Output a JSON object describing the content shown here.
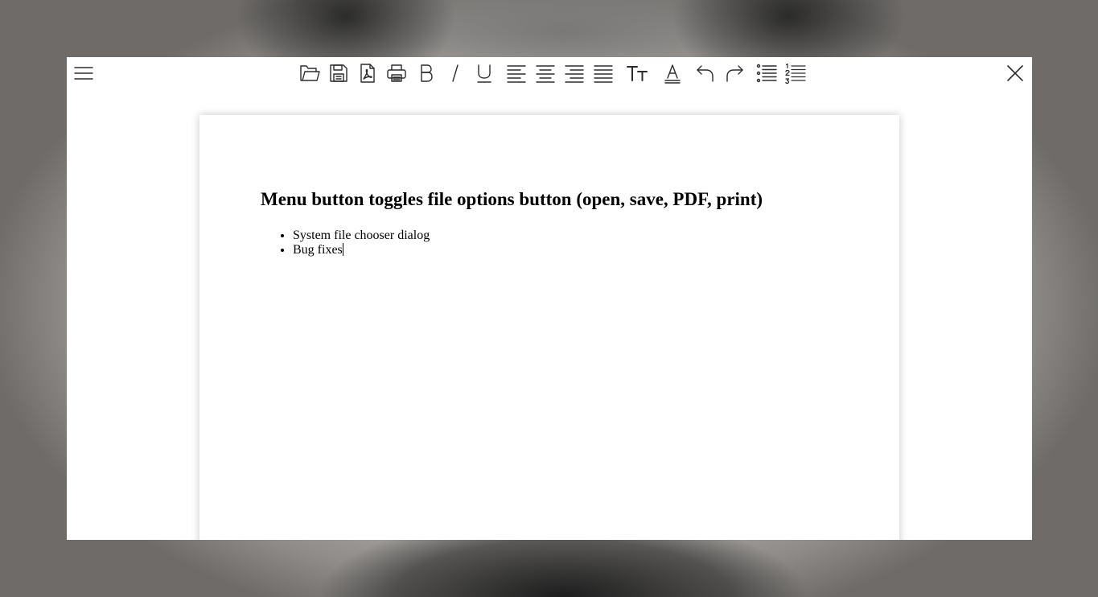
{
  "toolbar": {
    "menu_icon": "hamburger-menu-icon",
    "close_icon": "close-icon",
    "tools": [
      {
        "name": "open",
        "icon": "folder-open-icon"
      },
      {
        "name": "save",
        "icon": "save-icon"
      },
      {
        "name": "pdf",
        "icon": "pdf-icon"
      },
      {
        "name": "print",
        "icon": "printer-icon"
      },
      {
        "name": "bold",
        "icon": "bold-icon"
      },
      {
        "name": "italic",
        "icon": "italic-icon"
      },
      {
        "name": "underline",
        "icon": "underline-icon"
      },
      {
        "name": "align-left",
        "icon": "align-left-icon"
      },
      {
        "name": "align-center",
        "icon": "align-center-icon"
      },
      {
        "name": "align-right",
        "icon": "align-right-icon"
      },
      {
        "name": "align-justify",
        "icon": "align-justify-icon"
      },
      {
        "name": "font-size",
        "icon": "font-size-icon"
      },
      {
        "name": "font-color",
        "icon": "font-color-icon"
      },
      {
        "name": "undo",
        "icon": "undo-icon"
      },
      {
        "name": "redo",
        "icon": "redo-icon"
      },
      {
        "name": "bullet-list",
        "icon": "bullet-list-icon"
      },
      {
        "name": "numbered-list",
        "icon": "numbered-list-icon"
      }
    ]
  },
  "document": {
    "heading": "Menu button toggles file options button (open, save, PDF, print)",
    "items": [
      "System file chooser dialog",
      "Bug fixes"
    ]
  },
  "colors": {
    "window_background": "#ffffff",
    "icon_stroke": "#2b2b2b",
    "text": "#000000"
  }
}
